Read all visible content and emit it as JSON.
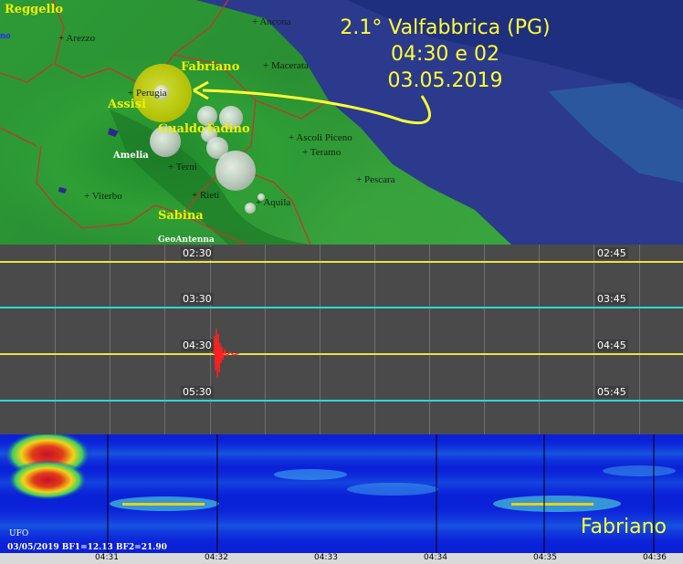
{
  "map": {
    "yellow_labels": {
      "reggello": "Reggello",
      "fabriano": "Fabriano",
      "assisi": "Assisi",
      "gualdo": "GualdoTadino",
      "sabina": "Sabina"
    },
    "white_labels": {
      "amelia": "Amelia",
      "geoantenna": "GeoAntenna"
    },
    "blue_label": "no",
    "cities": {
      "arezzo": "+ Arezzo",
      "ancona": "+ Ancona",
      "macerata": "+ Macerata",
      "ascoli": "+ Ascoli Piceno",
      "teramo": "+ Teramo",
      "pescara": "+ Pescara",
      "viterbo": "+ Viterbo",
      "terni": "+ Terni",
      "rieti": "+ Rieti",
      "aquila": "+ Aquila",
      "perugia": "+ Perugia"
    },
    "annotation": {
      "line1": "2.1° Valfabbrica (PG)",
      "line2": "04:30 e 02",
      "line3": "03.05.2019"
    },
    "colors": {
      "annotation": "#ffff33",
      "labels": "#f1f100",
      "highlight_quake": "#d6d000"
    }
  },
  "seismogram": {
    "rows": [
      {
        "left_time": "02:30",
        "right_time": "02:45",
        "color": "#e8e34a"
      },
      {
        "left_time": "03:30",
        "right_time": "03:45",
        "color": "#2fd7d7"
      },
      {
        "left_time": "04:30",
        "right_time": "04:45",
        "color": "#e8e34a"
      },
      {
        "left_time": "05:30",
        "right_time": "05:45",
        "color": "#2fd7d7"
      }
    ],
    "event_color": "#ff2020"
  },
  "spectrogram": {
    "station": "Fabriano",
    "ufo": "UFO",
    "info": "03/05/2019 BF1=12.13 BF2=21.90",
    "x_labels": [
      "04:31",
      "04:32",
      "04:33",
      "04:34",
      "04:35",
      "04:36"
    ]
  }
}
